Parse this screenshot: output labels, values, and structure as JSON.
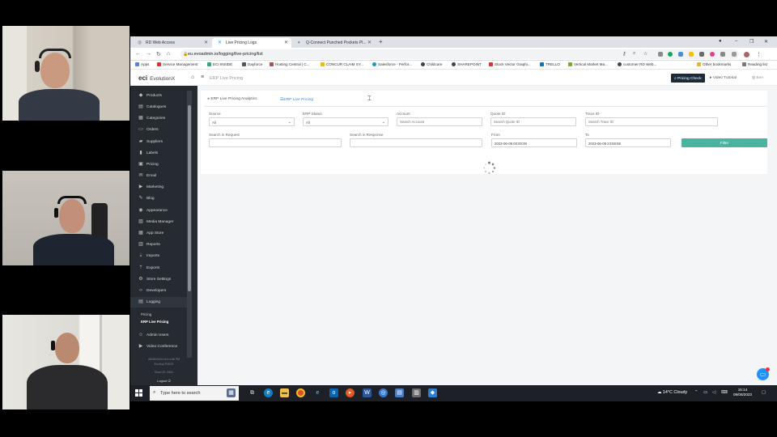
{
  "participants": [
    "participant-1",
    "participant-2",
    "participant-3"
  ],
  "browser": {
    "tabs": [
      {
        "title": "RD Web Access"
      },
      {
        "title": "Live Pricing Logs"
      },
      {
        "title": "Q-Connect Punched Pockets Pl..."
      }
    ],
    "url": "eu.evoadmin.io/logging/live-pricing/list",
    "bookmarks": [
      "Apps",
      "Service Management",
      "ECI INSIDE",
      "Dayforce",
      "Hosting Central | C...",
      "CONCUR CLAIM SY...",
      "Salesforce - Perfor...",
      "Childcare",
      "SHAREPOINT",
      "Stock Vector Graphi...",
      "TRELLO",
      "Vertical Market Ma...",
      "customer RD Web...",
      "Other bookmarks",
      "Reading list"
    ]
  },
  "app": {
    "logo_mark": "eci",
    "logo_text": "EvolutionX",
    "page_title": "ERP Live Pricing",
    "pricing_check": "Pricing Check",
    "video_tutorial": "Video Tutorial",
    "user": "Ben"
  },
  "sidebar": {
    "items": [
      "Products",
      "Catalogues",
      "Categories",
      "Orders",
      "Suppliers",
      "Labels",
      "Pricing",
      "Email",
      "Marketing",
      "Blog",
      "Appearance",
      "Media Manager",
      "App Store",
      "Reports",
      "Imports",
      "Exports",
      "Store Settings",
      "Developers",
      "Logging",
      "Admin Users",
      "Video Conference"
    ],
    "sub_items": [
      "Pricing",
      "ERP Live Pricing"
    ],
    "footer_line1": "09/06/2023 15:14:58 PM",
    "footer_line2": "EvoSupTNE20",
    "footer_line3": "Store ID: 3081",
    "logout": "Logout"
  },
  "panel": {
    "tab_analytics": "ERP Live Pricing Analytics",
    "tab_live": "ERP Live Pricing",
    "labels": {
      "source": "Source",
      "erp_status": "ERP Status",
      "account": "Account",
      "quote_id": "Quote ID",
      "trace_id": "Trace ID",
      "search_request": "Search in Request",
      "search_response": "Search in Response",
      "from": "From",
      "to": "To"
    },
    "values": {
      "source": "All",
      "erp_status": "All",
      "from": "2023-06-09 00:00:00",
      "to": "2023-06-09 23:59:59"
    },
    "placeholders": {
      "account": "Search Account",
      "quote_id": "Search Quote ID",
      "trace_id": "Search Trace ID"
    },
    "filter_button": "Filter"
  },
  "taskbar": {
    "search_placeholder": "Type here to search",
    "weather": "14°C  Cloudy",
    "time": "15:14",
    "date": "09/06/2023"
  }
}
